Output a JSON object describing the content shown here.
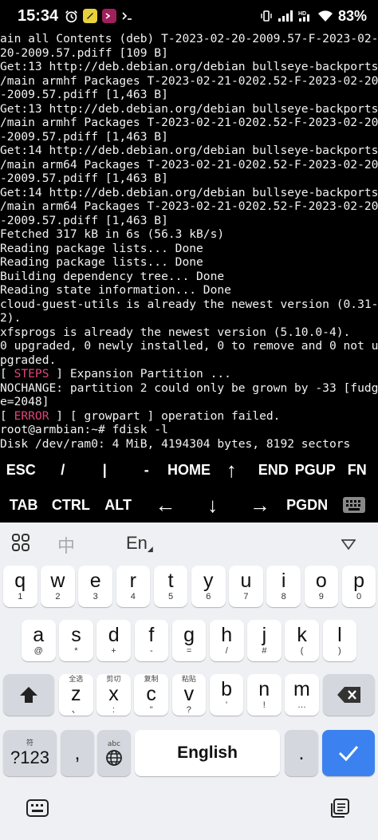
{
  "status": {
    "time": "15:34",
    "battery": "83%"
  },
  "terminal": {
    "lines": [
      "ain all Contents (deb) T-2023-02-20-2009.57-F-2023-02-",
      "20-2009.57.pdiff [109 B]",
      "Get:13 http://deb.debian.org/debian bullseye-backports",
      "/main armhf Packages T-2023-02-21-0202.52-F-2023-02-20",
      "-2009.57.pdiff [1,463 B]",
      "Get:13 http://deb.debian.org/debian bullseye-backports",
      "/main armhf Packages T-2023-02-21-0202.52-F-2023-02-20",
      "-2009.57.pdiff [1,463 B]",
      "Get:14 http://deb.debian.org/debian bullseye-backports",
      "/main arm64 Packages T-2023-02-21-0202.52-F-2023-02-20",
      "-2009.57.pdiff [1,463 B]",
      "Get:14 http://deb.debian.org/debian bullseye-backports",
      "/main arm64 Packages T-2023-02-21-0202.52-F-2023-02-20",
      "-2009.57.pdiff [1,463 B]",
      "Fetched 317 kB in 6s (56.3 kB/s)",
      "Reading package lists... Done",
      "Reading package lists... Done",
      "Building dependency tree... Done",
      "Reading state information... Done",
      "cloud-guest-utils is already the newest version (0.31-",
      "2).",
      "xfsprogs is already the newest version (5.10.0-4).",
      "0 upgraded, 0 newly installed, 0 to remove and 0 not u",
      "pgraded."
    ],
    "steps_open": "[ ",
    "steps_tag": "STEPS",
    "steps_rest": " ] Expansion Partition ...",
    "nochange_1": "NOCHANGE: partition 2 could only be grown by -33 [fudg",
    "nochange_2": "e=2048]",
    "error_open": "[ ",
    "error_tag": "ERROR",
    "error_rest": " ] [ growpart ] operation failed.",
    "prompt": "root@armbian:~# fdisk -l",
    "disk": "Disk /dev/ram0: 4 MiB, 4194304 bytes, 8192 sectors"
  },
  "extra_keys": {
    "row1": [
      "ESC",
      "/",
      "|",
      "-",
      "HOME",
      "↑",
      "END",
      "PGUP",
      "FN"
    ],
    "row2": [
      "TAB",
      "CTRL",
      "ALT",
      "←",
      "↓",
      "→",
      "PGDN"
    ]
  },
  "keyboard": {
    "toolbar": {
      "chinese": "中",
      "english": "En"
    },
    "row1": [
      {
        "k": "q",
        "s": "1"
      },
      {
        "k": "w",
        "s": "2"
      },
      {
        "k": "e",
        "s": "3"
      },
      {
        "k": "r",
        "s": "4"
      },
      {
        "k": "t",
        "s": "5"
      },
      {
        "k": "y",
        "s": "6"
      },
      {
        "k": "u",
        "s": "7"
      },
      {
        "k": "i",
        "s": "8"
      },
      {
        "k": "o",
        "s": "9"
      },
      {
        "k": "p",
        "s": "0"
      }
    ],
    "row2": [
      {
        "k": "a",
        "s": "@"
      },
      {
        "k": "s",
        "s": "*"
      },
      {
        "k": "d",
        "s": "+"
      },
      {
        "k": "f",
        "s": "-"
      },
      {
        "k": "g",
        "s": "="
      },
      {
        "k": "h",
        "s": "/"
      },
      {
        "k": "j",
        "s": "#"
      },
      {
        "k": "k",
        "s": "("
      },
      {
        "k": "l",
        "s": ")"
      }
    ],
    "row3": [
      {
        "k": "z",
        "s": "、",
        "t": "全选"
      },
      {
        "k": "x",
        "s": ":",
        "t": "剪切"
      },
      {
        "k": "c",
        "s": "\"",
        "t": "复制"
      },
      {
        "k": "v",
        "s": "?",
        "t": "粘贴"
      },
      {
        "k": "b",
        "s": "'",
        "t": ""
      },
      {
        "k": "n",
        "s": "!",
        "t": ""
      },
      {
        "k": "m",
        "s": "…",
        "t": ""
      }
    ],
    "sym_key": "?123",
    "sym_top": "符",
    "comma": ",",
    "lang_top": "abc",
    "space": "English",
    "period": "."
  }
}
